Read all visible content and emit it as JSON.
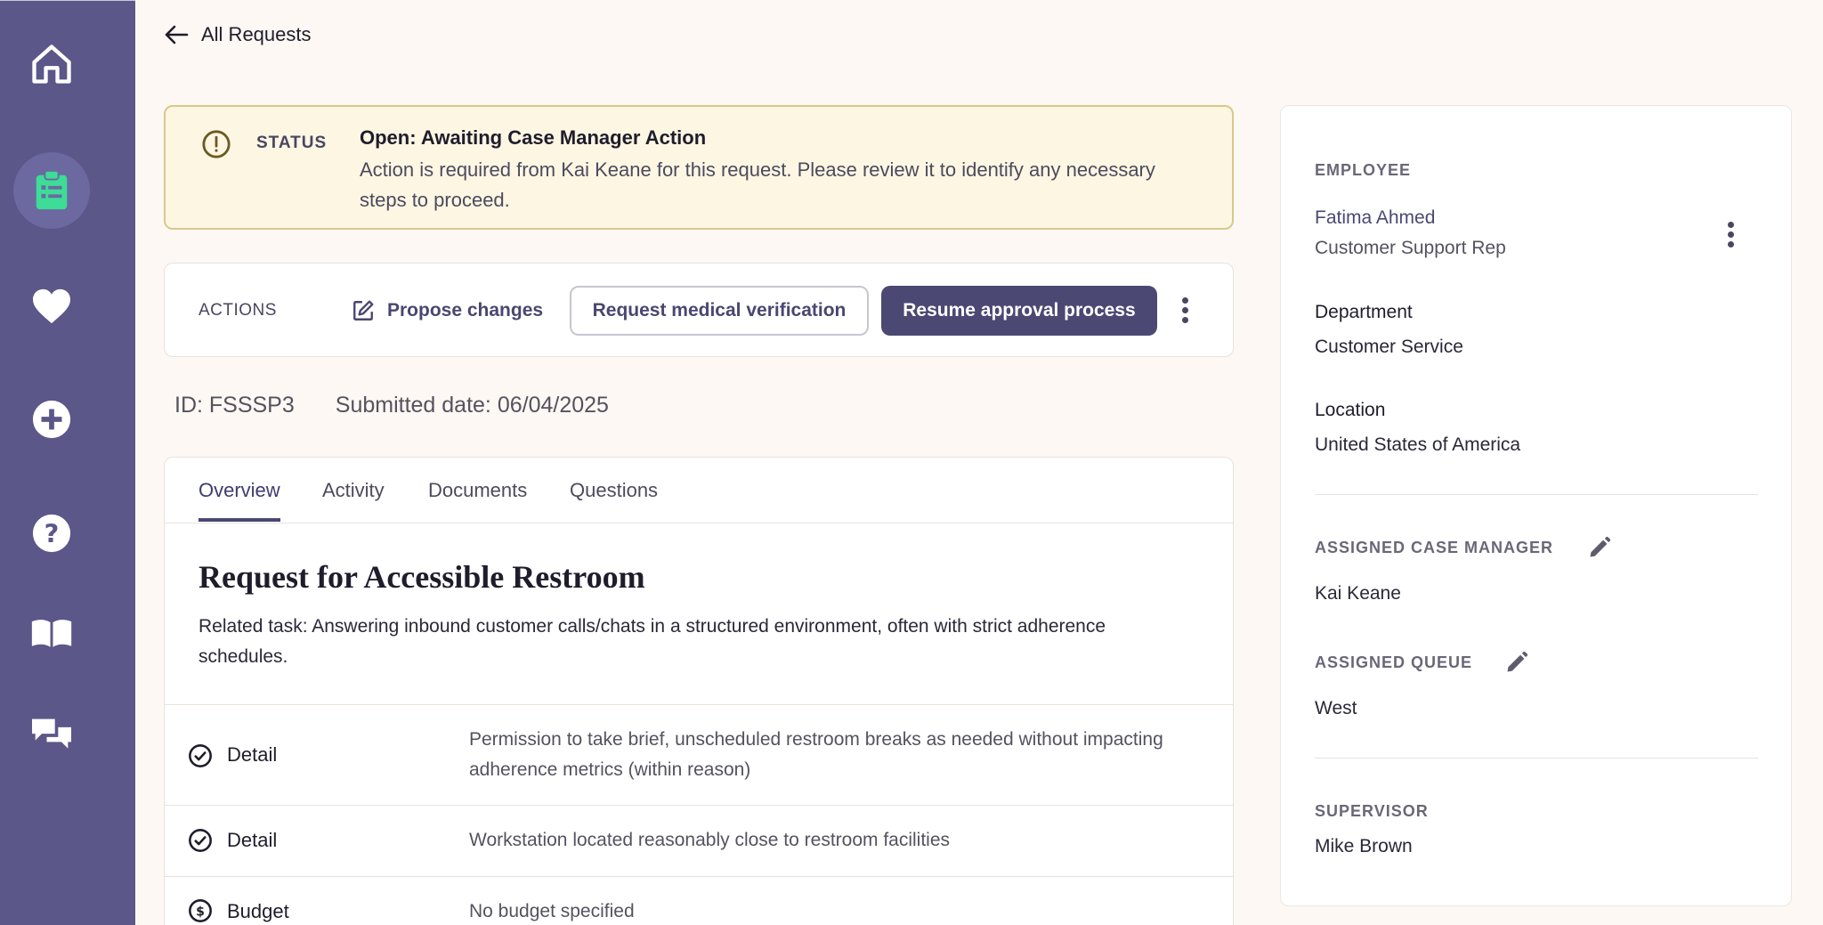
{
  "nav": {
    "items": [
      {
        "name": "home-icon"
      },
      {
        "name": "clipboard-icon",
        "active": true
      },
      {
        "name": "heart-icon"
      },
      {
        "name": "plus-circle-icon"
      },
      {
        "name": "help-icon"
      },
      {
        "name": "book-icon"
      },
      {
        "name": "chat-icon"
      }
    ],
    "active_color": "#3ddc97"
  },
  "back_link": {
    "label": "All Requests"
  },
  "status": {
    "label": "STATUS",
    "title": "Open: Awaiting Case Manager Action",
    "message": "Action is required from Kai Keane for this request. Please review it to identify any necessary steps to proceed."
  },
  "actions": {
    "label": "ACTIONS",
    "propose": "Propose changes",
    "verify": "Request medical verification",
    "resume": "Resume approval process"
  },
  "meta": {
    "id": "ID: FSSSP3",
    "submitted": "Submitted date: 06/04/2025"
  },
  "tabs": [
    "Overview",
    "Activity",
    "Documents",
    "Questions"
  ],
  "request": {
    "title": "Request for Accessible Restroom",
    "related": "Related task: Answering inbound customer calls/chats in a structured environment, often with strict adherence schedules.",
    "rows": [
      {
        "label": "Detail",
        "icon": "check-circle-icon",
        "value": "Permission to take brief, unscheduled restroom breaks as needed without impacting adherence metrics (within reason)"
      },
      {
        "label": "Detail",
        "icon": "check-circle-icon",
        "value": "Workstation located reasonably close to restroom facilities"
      },
      {
        "label": "Budget",
        "icon": "dollar-circle-icon",
        "value": "No budget specified"
      }
    ]
  },
  "employee": {
    "section": "EMPLOYEE",
    "name": "Fatima Ahmed",
    "role": "Customer Support Rep",
    "department_label": "Department",
    "department": "Customer Service",
    "location_label": "Location",
    "location": "United States of America"
  },
  "case_manager": {
    "section": "ASSIGNED CASE MANAGER",
    "name": "Kai Keane"
  },
  "queue": {
    "section": "ASSIGNED QUEUE",
    "name": "West"
  },
  "supervisor": {
    "section": "SUPERVISOR",
    "name": "Mike Brown"
  }
}
